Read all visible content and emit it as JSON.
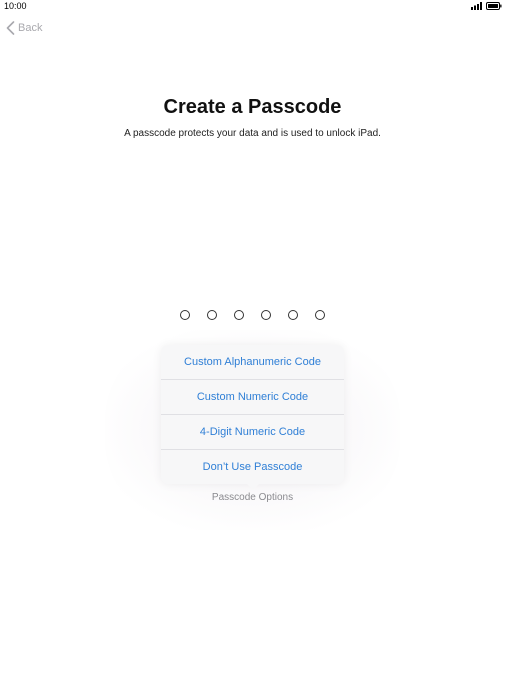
{
  "status_bar": {
    "time": "10:00",
    "signal_icon": "signal-bars-icon",
    "battery_icon": "battery-icon"
  },
  "nav": {
    "back_label": "Back",
    "back_icon": "chevron-left-icon"
  },
  "header": {
    "title": "Create a Passcode",
    "subtitle": "A passcode protects your data and is used to unlock iPad."
  },
  "passcode": {
    "digits_total": 6,
    "digits_entered": 0
  },
  "options_menu": {
    "items": [
      {
        "label": "Custom Alphanumeric Code"
      },
      {
        "label": "Custom Numeric Code"
      },
      {
        "label": "4-Digit Numeric Code"
      },
      {
        "label": "Don’t Use Passcode"
      }
    ],
    "caption": "Passcode Options"
  },
  "colors": {
    "accent": "#2f7fd6",
    "back_text": "#a9a9ae",
    "caption_text": "#8a8a8f"
  }
}
